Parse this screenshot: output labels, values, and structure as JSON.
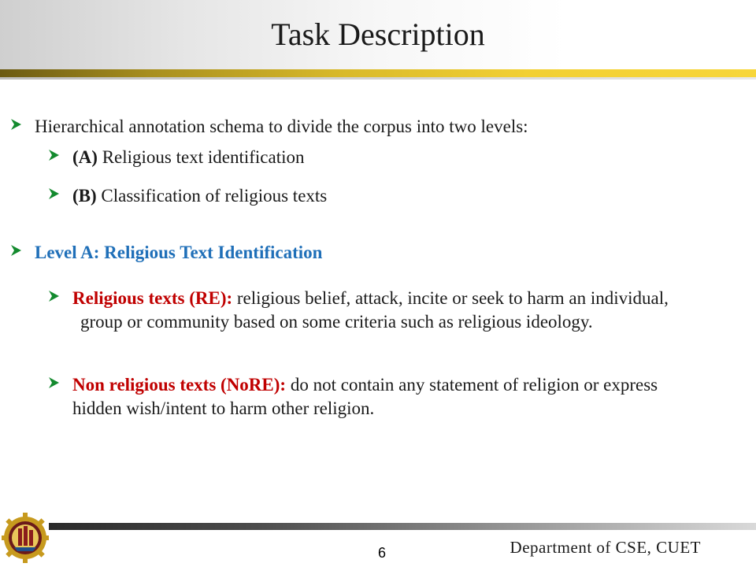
{
  "header": {
    "title": "Task Description"
  },
  "colors": {
    "bullet_arrow": "#138a2e",
    "emphasis_red": "#c00000",
    "heading_blue": "#1f6fb8",
    "header_rule_gold": "#e8c530"
  },
  "bullets": {
    "intro": "Hierarchical annotation schema to divide the corpus into two levels:",
    "level_a_label": "(A)",
    "level_a_text": " Religious text identification",
    "level_b_label": "(B)",
    "level_b_text": " Classification of religious texts",
    "level_a_heading": "Level A: Religious Text Identification",
    "re_label": "Religious texts (RE):",
    "re_text": " religious belief, attack, incite or seek to harm an individual, group or community based on some criteria such as religious ideology.",
    "nore_label": "Non religious texts (NoRE):",
    "nore_text": " do not contain any statement of religion or express hidden wish/intent to harm other religion."
  },
  "footer": {
    "page_number": "6",
    "department": "Department of CSE, CUET",
    "logo_icon": "university-seal-icon"
  }
}
